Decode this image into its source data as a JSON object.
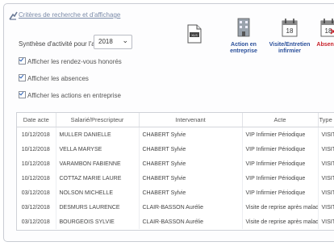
{
  "criteria_link": "Critères de recherche et d'affichage",
  "year_label": "Synthèse d'activité pour l'année :",
  "year_value": "2018",
  "checkboxes": [
    "Afficher les rendez-vous honorés",
    "Afficher les absences",
    "Afficher les actions en entreprise"
  ],
  "actions": [
    {
      "label": "Action en entreprise",
      "color": "#2a4f9a"
    },
    {
      "label": "Visite/Entretien infirmier",
      "color": "#2a4f9a"
    },
    {
      "label": "Absence",
      "color": "#c8222a"
    }
  ],
  "table": {
    "headers": [
      "Date acte",
      "Salarié/Prescripteur",
      "Intervenant",
      "Acte",
      "Type d'acte"
    ],
    "rows": [
      [
        "10/12/2018",
        "MULLER DANIELLE",
        "CHABERT Sylvie",
        "VIP Infirmier Périodique",
        "VISITE"
      ],
      [
        "10/12/2018",
        "VELLA MARYSE",
        "CHABERT Sylvie",
        "VIP Infirmier Périodique",
        "VISITE"
      ],
      [
        "10/12/2018",
        "VARAMBON FABIENNE",
        "CHABERT Sylvie",
        "VIP Infirmier Périodique",
        "VISITE"
      ],
      [
        "10/12/2018",
        "COTTAZ MARIE LAURE",
        "CHABERT Sylvie",
        "VIP Infirmier Périodique",
        "VISITE"
      ],
      [
        "03/12/2018",
        "NOLSON MICHELLE",
        "CHABERT Sylvie",
        "VIP Infirmier Périodique",
        "VISITE"
      ],
      [
        "03/12/2018",
        "DESMURS LAURENCE",
        "CLAIR-BASSON Aurélie",
        "Visite de reprise après maladie",
        "VISITE"
      ],
      [
        "03/12/2018",
        "BOURGEOIS SYLVIE",
        "CLAIR-BASSON Aurélie",
        "Visite de reprise après maladie",
        "VISITE"
      ]
    ]
  }
}
